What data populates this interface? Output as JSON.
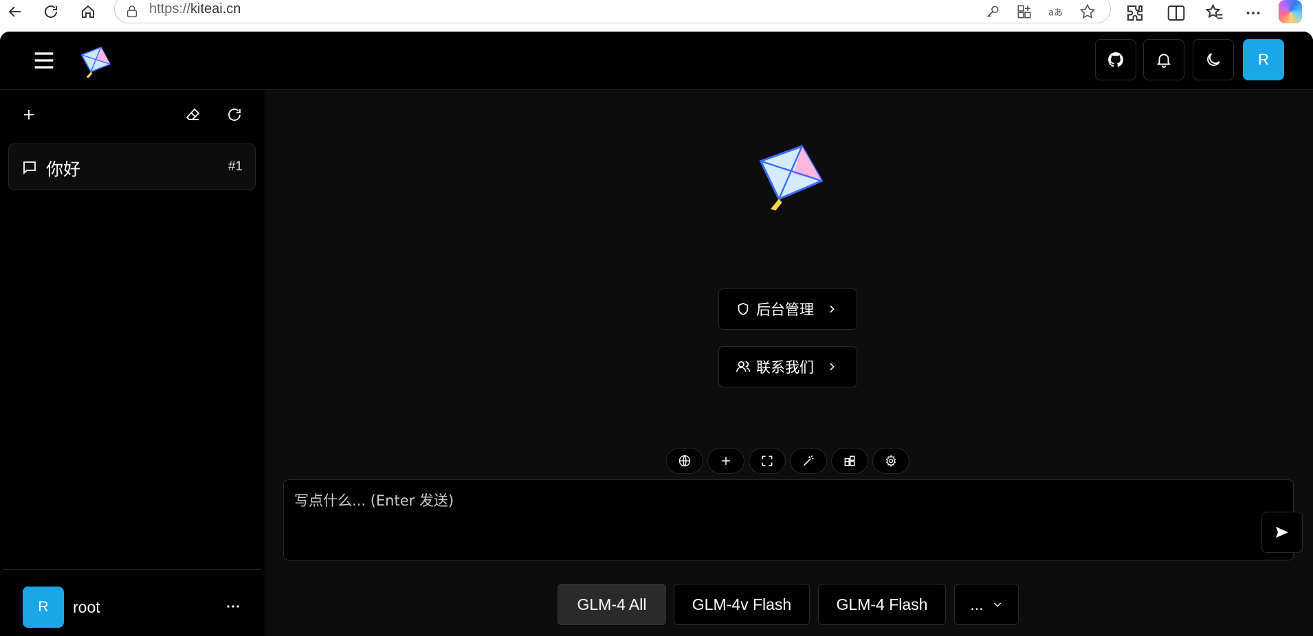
{
  "browser": {
    "url_scheme": "https://",
    "url_host": "kiteai.cn"
  },
  "topbar": {
    "avatar_letter": "R"
  },
  "sidebar": {
    "conversations": [
      {
        "title": "你好",
        "number": "#1"
      }
    ],
    "user": {
      "avatar_letter": "R",
      "name": "root"
    }
  },
  "main": {
    "links": [
      {
        "label": "后台管理",
        "icon": "shield-icon"
      },
      {
        "label": "联系我们",
        "icon": "users-icon"
      }
    ],
    "tools": [
      "globe-icon",
      "plus-icon",
      "expand-icon",
      "magic-wand-icon",
      "apps-icon",
      "settings-icon"
    ],
    "input_placeholder": "写点什么... (Enter 发送)",
    "models": [
      {
        "label": "GLM-4 All",
        "active": true
      },
      {
        "label": "GLM-4v Flash",
        "active": false
      },
      {
        "label": "GLM-4 Flash",
        "active": false
      },
      {
        "label": "...",
        "active": false
      }
    ]
  },
  "colors": {
    "accent": "#1aa7e8",
    "background": "#000000",
    "main_background": "#0d0d0d"
  }
}
